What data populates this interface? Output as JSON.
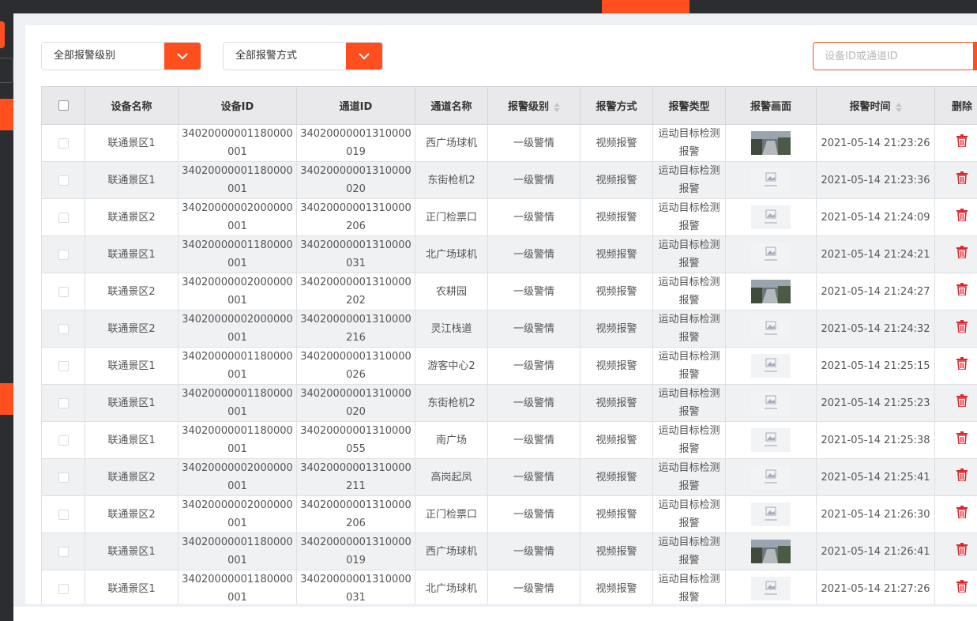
{
  "filters": {
    "level_label": "全部报警级别",
    "mode_label": "全部报警方式",
    "search_placeholder": "设备ID或通道ID"
  },
  "table": {
    "headers": {
      "device_name": "设备名称",
      "device_id": "设备ID",
      "channel_id": "通道ID",
      "channel_name": "通道名称",
      "alarm_level": "报警级别",
      "alarm_mode": "报警方式",
      "alarm_type": "报警类型",
      "alarm_image": "报警画面",
      "alarm_time": "报警时间",
      "delete": "删除"
    },
    "rows": [
      {
        "device_name": "联通景区1",
        "device_id": "34020000001180000001",
        "channel_id": "34020000001310000019",
        "channel_name": "西广场球机",
        "level": "一级警情",
        "mode": "视频报警",
        "type": "运动目标检测报警",
        "image": "snapshot",
        "time": "2021-05-14 21:23:26"
      },
      {
        "device_name": "联通景区1",
        "device_id": "34020000001180000001",
        "channel_id": "34020000001310000020",
        "channel_name": "东街枪机2",
        "level": "一级警情",
        "mode": "视频报警",
        "type": "运动目标检测报警",
        "image": "no-image",
        "time": "2021-05-14 21:23:36"
      },
      {
        "device_name": "联通景区2",
        "device_id": "34020000002000000001",
        "channel_id": "34020000001310000206",
        "channel_name": "正门检票口",
        "level": "一级警情",
        "mode": "视频报警",
        "type": "运动目标检测报警",
        "image": "no-image",
        "time": "2021-05-14 21:24:09"
      },
      {
        "device_name": "联通景区1",
        "device_id": "34020000001180000001",
        "channel_id": "34020000001310000031",
        "channel_name": "北广场球机",
        "level": "一级警情",
        "mode": "视频报警",
        "type": "运动目标检测报警",
        "image": "no-image",
        "time": "2021-05-14 21:24:21"
      },
      {
        "device_name": "联通景区2",
        "device_id": "34020000002000000001",
        "channel_id": "34020000001310000202",
        "channel_name": "农耕园",
        "level": "一级警情",
        "mode": "视频报警",
        "type": "运动目标检测报警",
        "image": "snapshot",
        "time": "2021-05-14 21:24:27"
      },
      {
        "device_name": "联通景区2",
        "device_id": "34020000002000000001",
        "channel_id": "34020000001310000216",
        "channel_name": "灵江栈道",
        "level": "一级警情",
        "mode": "视频报警",
        "type": "运动目标检测报警",
        "image": "no-image",
        "time": "2021-05-14 21:24:32"
      },
      {
        "device_name": "联通景区1",
        "device_id": "34020000001180000001",
        "channel_id": "34020000001310000026",
        "channel_name": "游客中心2",
        "level": "一级警情",
        "mode": "视频报警",
        "type": "运动目标检测报警",
        "image": "no-image",
        "time": "2021-05-14 21:25:15"
      },
      {
        "device_name": "联通景区1",
        "device_id": "34020000001180000001",
        "channel_id": "34020000001310000020",
        "channel_name": "东街枪机2",
        "level": "一级警情",
        "mode": "视频报警",
        "type": "运动目标检测报警",
        "image": "no-image",
        "time": "2021-05-14 21:25:23"
      },
      {
        "device_name": "联通景区1",
        "device_id": "34020000001180000001",
        "channel_id": "34020000001310000055",
        "channel_name": "南广场",
        "level": "一级警情",
        "mode": "视频报警",
        "type": "运动目标检测报警",
        "image": "no-image",
        "time": "2021-05-14 21:25:38"
      },
      {
        "device_name": "联通景区2",
        "device_id": "34020000002000000001",
        "channel_id": "34020000001310000211",
        "channel_name": "高岗起凤",
        "level": "一级警情",
        "mode": "视频报警",
        "type": "运动目标检测报警",
        "image": "no-image",
        "time": "2021-05-14 21:25:41"
      },
      {
        "device_name": "联通景区2",
        "device_id": "34020000002000000001",
        "channel_id": "34020000001310000206",
        "channel_name": "正门检票口",
        "level": "一级警情",
        "mode": "视频报警",
        "type": "运动目标检测报警",
        "image": "no-image",
        "time": "2021-05-14 21:26:30"
      },
      {
        "device_name": "联通景区1",
        "device_id": "34020000001180000001",
        "channel_id": "34020000001310000019",
        "channel_name": "西广场球机",
        "level": "一级警情",
        "mode": "视频报警",
        "type": "运动目标检测报警",
        "image": "snapshot",
        "time": "2021-05-14 21:26:41"
      },
      {
        "device_name": "联通景区1",
        "device_id": "34020000001180000001",
        "channel_id": "34020000001310000031",
        "channel_name": "北广场球机",
        "level": "一级警情",
        "mode": "视频报警",
        "type": "运动目标检测报警",
        "image": "no-image",
        "time": "2021-05-14 21:27:26"
      }
    ]
  },
  "colors": {
    "accent": "#ff4f1f",
    "delete": "#e0242b",
    "header_bg": "#e9e9eb",
    "stripe_bg": "#f0f1f3"
  }
}
